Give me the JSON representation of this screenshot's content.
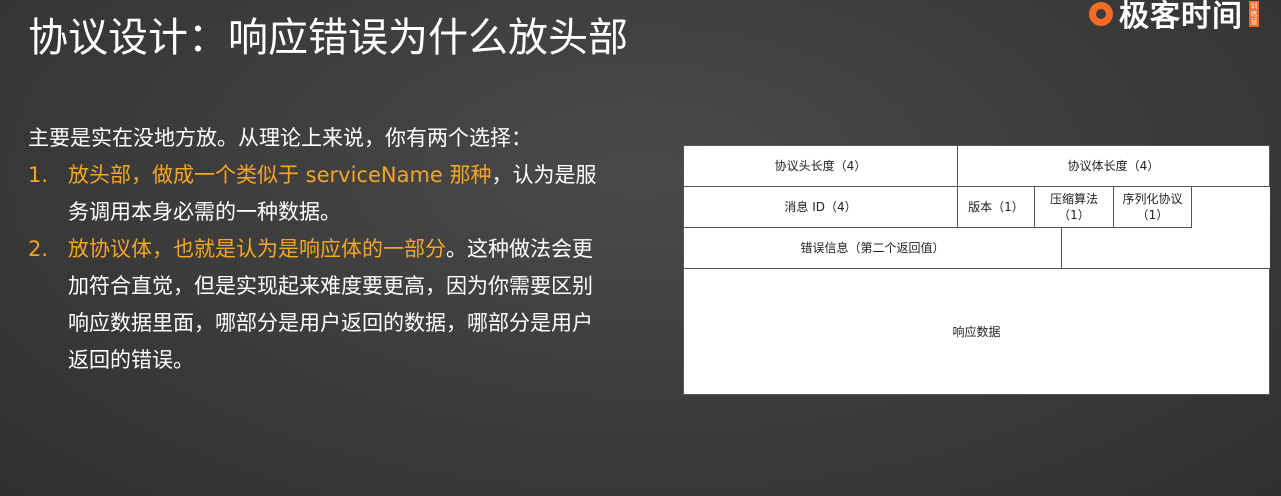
{
  "slide": {
    "title": "协议设计：响应错误为什么放头部",
    "logo_text": "极客时间",
    "logo_badge": "训练营",
    "intro": "主要是实在没地方放。从理论上来说，你有两个选择：",
    "items": [
      {
        "num": "1.",
        "highlight": "放头部，做成一个类似于 serviceName 那种",
        "rest": "，认为是服务调用本身必需的一种数据。"
      },
      {
        "num": "2.",
        "highlight": "放协议体，也就是认为是响应体的一部分",
        "rest": "。这种做法会更加符合直觉，但是实现起来难度要更高，因为你需要区别响应数据里面，哪部分是用户返回的数据，哪部分是用户返回的错误。"
      }
    ]
  },
  "diagram": {
    "header_length": "协议头长度（4）",
    "body_length": "协议体长度（4）",
    "message_id": "消息 ID（4）",
    "version": "版本（1）",
    "compress_line1": "压缩算法",
    "compress_line2": "（1）",
    "serialize_line1": "序列化协议",
    "serialize_line2": "（1）",
    "error_info": "错误信息（第二个返回值）",
    "response_data": "响应数据"
  }
}
